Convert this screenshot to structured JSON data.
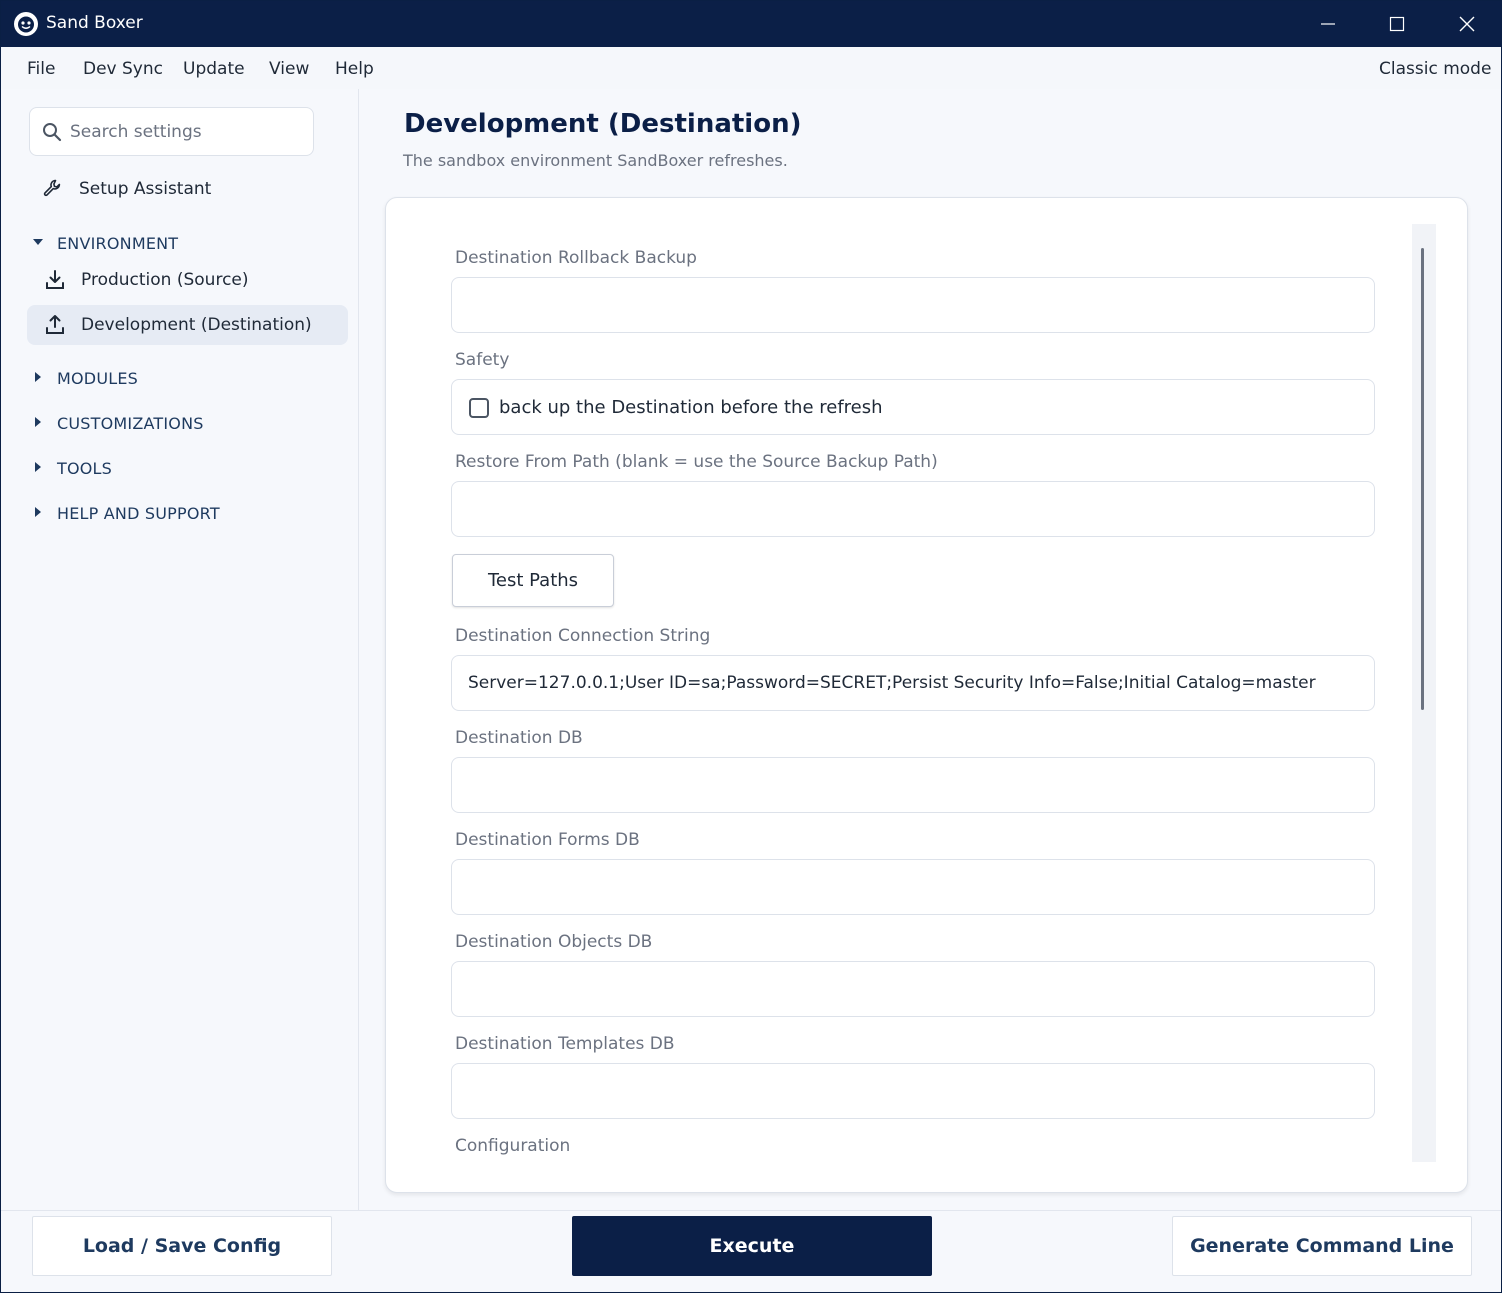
{
  "window": {
    "title": "Sand Boxer"
  },
  "menu": {
    "items": [
      "File",
      "Dev Sync",
      "Update",
      "View",
      "Help"
    ],
    "classic_mode": "Classic mode"
  },
  "sidebar": {
    "search_placeholder": "Search settings",
    "setup_assistant": "Setup Assistant",
    "sections": {
      "environment": "ENVIRONMENT",
      "modules": "MODULES",
      "customizations": "CUSTOMIZATIONS",
      "tools": "TOOLS",
      "help_support": "HELP AND SUPPORT"
    },
    "environment_items": [
      "Production (Source)",
      "Development (Destination)"
    ],
    "selected_item": "Development (Destination)"
  },
  "page": {
    "title": "Development (Destination)",
    "subtitle": "The sandbox environment SandBoxer refreshes."
  },
  "form": {
    "rollback_label": "Destination Rollback Backup",
    "rollback_value": "",
    "safety_label": "Safety",
    "safety_checkbox_label": "back up the Destination before the refresh",
    "safety_checked": false,
    "restore_label": "Restore From Path (blank = use the Source Backup Path)",
    "restore_value": "",
    "test_paths_button": "Test Paths",
    "connection_label": "Destination Connection String",
    "connection_value": "Server=127.0.0.1;User ID=sa;Password=SECRET;Persist Security Info=False;Initial Catalog=master",
    "db_label": "Destination DB",
    "db_value": "",
    "forms_db_label": "Destination Forms DB",
    "forms_db_value": "",
    "objects_db_label": "Destination Objects DB",
    "objects_db_value": "",
    "templates_db_label": "Destination Templates DB",
    "templates_db_value": "",
    "configuration_label": "Configuration"
  },
  "footer": {
    "load_save": "Load / Save Config",
    "execute": "Execute",
    "generate": "Generate Command Line"
  },
  "colors": {
    "titlebar": "#0b1f47",
    "accent": "#0b1f47",
    "selected_bg": "#e6ebf4"
  }
}
